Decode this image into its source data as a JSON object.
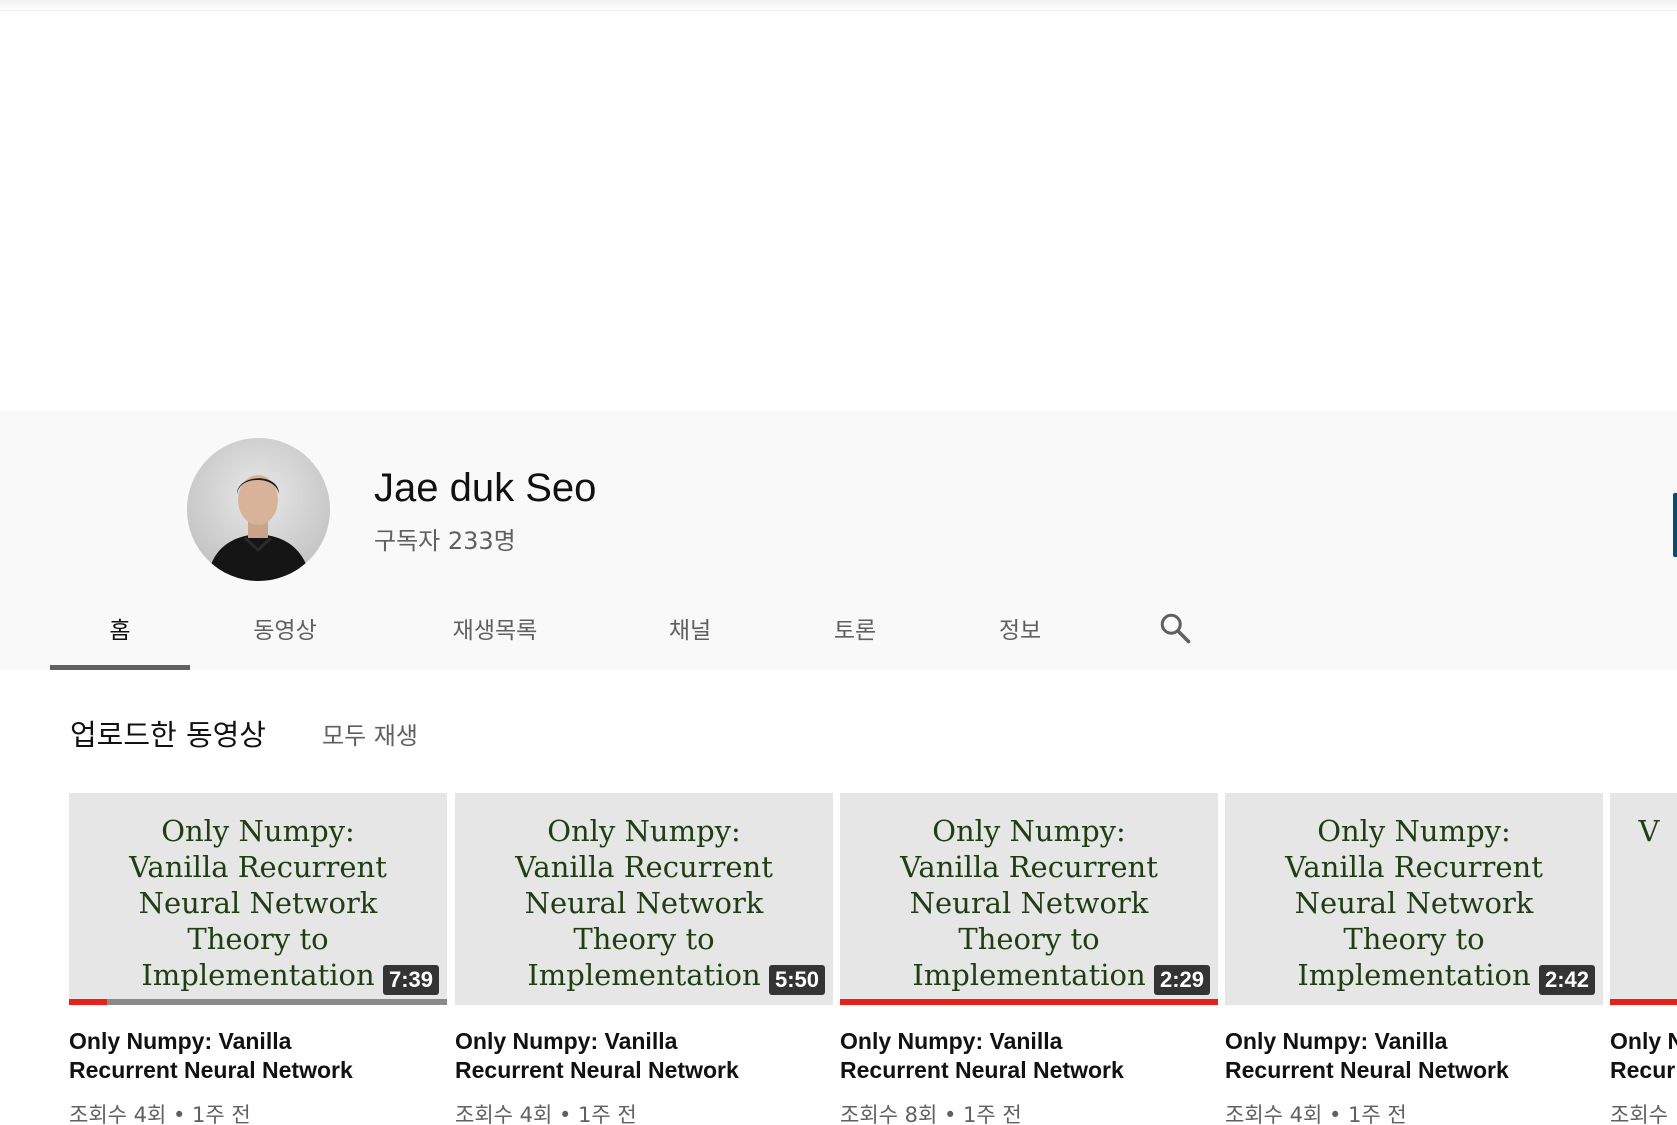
{
  "channel": {
    "name": "Jae duk Seo",
    "subscribers": "구독자 233명"
  },
  "tabs": [
    {
      "label": "홈",
      "active": true
    },
    {
      "label": "동영상",
      "active": false
    },
    {
      "label": "재생목록",
      "active": false
    },
    {
      "label": "채널",
      "active": false
    },
    {
      "label": "토론",
      "active": false
    },
    {
      "label": "정보",
      "active": false
    }
  ],
  "section": {
    "title": "업로드한 동영상",
    "play_all": "모두 재생"
  },
  "videos": [
    {
      "thumb_lines": [
        "Only Numpy:",
        "Vanilla Recurrent",
        "Neural Network",
        "Theory to",
        "Implementation"
      ],
      "duration": "7:39",
      "progress": 0.1,
      "title_line1": "Only Numpy: Vanilla",
      "title_line2": "Recurrent Neural Network",
      "meta": "조회수 4회 • 1주 전"
    },
    {
      "thumb_lines": [
        "Only Numpy:",
        "Vanilla Recurrent",
        "Neural Network",
        "Theory to",
        "Implementation"
      ],
      "duration": "5:50",
      "progress": 0,
      "title_line1": "Only Numpy: Vanilla",
      "title_line2": "Recurrent Neural Network",
      "meta": "조회수 4회 • 1주 전"
    },
    {
      "thumb_lines": [
        "Only Numpy:",
        "Vanilla Recurrent",
        "Neural Network",
        "Theory to",
        "Implementation"
      ],
      "duration": "2:29",
      "progress": 1.0,
      "title_line1": "Only Numpy: Vanilla",
      "title_line2": "Recurrent Neural Network",
      "meta": "조회수 8회 • 1주 전"
    },
    {
      "thumb_lines": [
        "Only Numpy:",
        "Vanilla Recurrent",
        "Neural Network",
        "Theory to",
        "Implementation"
      ],
      "duration": "2:42",
      "progress": 0,
      "title_line1": "Only Numpy: Vanilla",
      "title_line2": "Recurrent Neural Network",
      "meta": "조회수 4회 • 1주 전"
    },
    {
      "thumb_lines": [
        "",
        "V",
        "",
        "",
        ""
      ],
      "duration": "",
      "progress": 0.2,
      "title_line1": "Only N",
      "title_line2": "Recur",
      "meta": "조회수"
    }
  ],
  "colors": {
    "accent_red": "#e62117",
    "header_bg": "#f9f9f9",
    "thumb_text": "#1f3f12"
  },
  "icons": {
    "search": "search-icon"
  }
}
